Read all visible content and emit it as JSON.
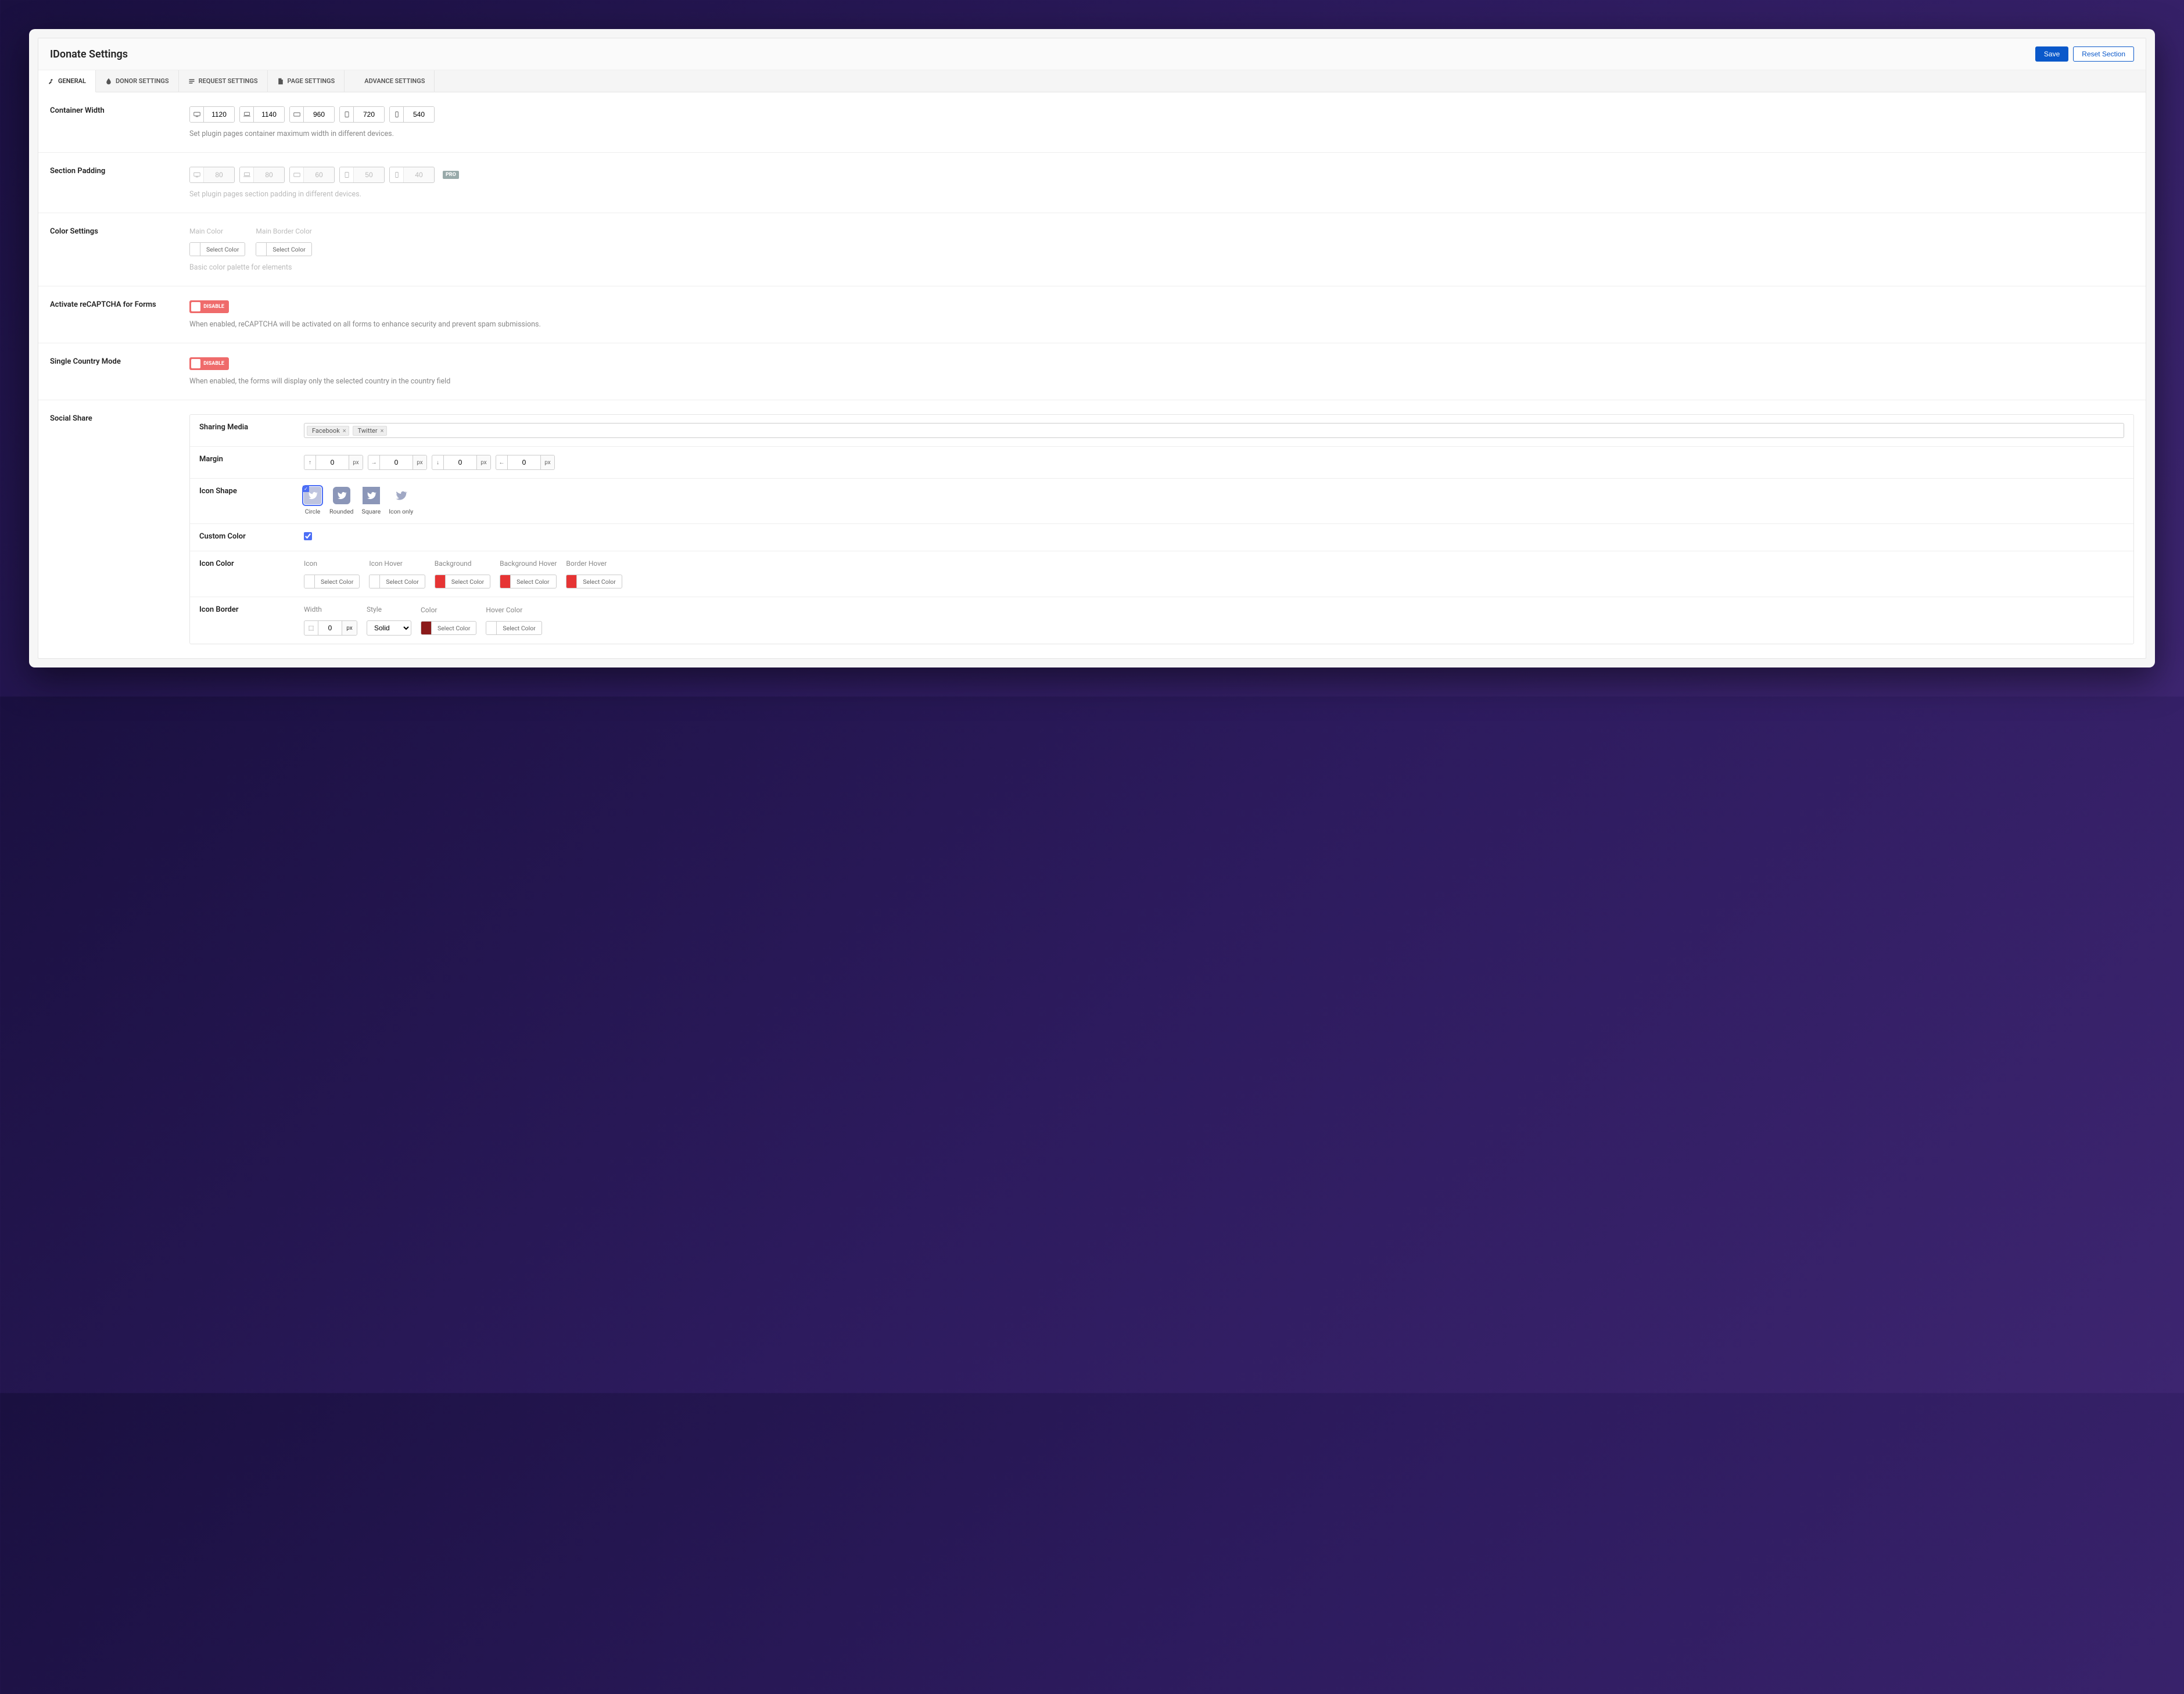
{
  "header": {
    "title": "IDonate Settings",
    "save": "Save",
    "reset": "Reset Section"
  },
  "tabs": [
    {
      "id": "general",
      "label": "GENERAL"
    },
    {
      "id": "donor",
      "label": "DONOR SETTINGS"
    },
    {
      "id": "request",
      "label": "REQUEST SETTINGS"
    },
    {
      "id": "page",
      "label": "PAGE SETTINGS"
    },
    {
      "id": "advance",
      "label": "ADVANCE SETTINGS"
    }
  ],
  "containerWidth": {
    "label": "Container Width",
    "values": [
      "1120",
      "1140",
      "960",
      "720",
      "540"
    ],
    "desc": "Set plugin pages container maximum width in different devices."
  },
  "sectionPadding": {
    "label": "Section Padding",
    "values": [
      "80",
      "80",
      "60",
      "50",
      "40"
    ],
    "badge": "PRO",
    "desc": "Set plugin pages section padding in different devices."
  },
  "colorSettings": {
    "label": "Color Settings",
    "main": "Main Color",
    "border": "Main Border Color",
    "select": "Select Color",
    "desc": "Basic color palette for elements"
  },
  "recaptcha": {
    "label": "Activate reCAPTCHA for Forms",
    "toggle": "DISABLE",
    "desc": "When enabled, reCAPTCHA will be activated on all forms to enhance security and prevent spam submissions."
  },
  "singleCountry": {
    "label": "Single Country Mode",
    "toggle": "DISABLE",
    "desc": "When enabled, the forms will display only the selected country in the country field"
  },
  "socialShare": {
    "label": "Social Share",
    "sharingMedia": {
      "label": "Sharing Media",
      "tags": [
        "Facebook",
        "Twitter"
      ]
    },
    "margin": {
      "label": "Margin",
      "items": [
        {
          "arrow": "↑",
          "value": "0",
          "unit": "px"
        },
        {
          "arrow": "→",
          "value": "0",
          "unit": "px"
        },
        {
          "arrow": "↓",
          "value": "0",
          "unit": "px"
        },
        {
          "arrow": "←",
          "value": "0",
          "unit": "px"
        }
      ]
    },
    "iconShape": {
      "label": "Icon Shape",
      "options": [
        "Circle",
        "Rounded",
        "Square",
        "Icon only"
      ]
    },
    "customColor": {
      "label": "Custom Color",
      "checked": true
    },
    "iconColor": {
      "label": "Icon Color",
      "columns": [
        "Icon",
        "Icon Hover",
        "Background",
        "Background Hover",
        "Border Hover"
      ],
      "select": "Select Color"
    },
    "iconBorder": {
      "label": "Icon Border",
      "width": "Width",
      "widthVal": "0",
      "widthUnit": "px",
      "style": "Style",
      "styleVal": "Solid",
      "color": "Color",
      "colorSelect": "Select Color",
      "hoverColor": "Hover Color",
      "hoverSelect": "Select Color"
    }
  }
}
